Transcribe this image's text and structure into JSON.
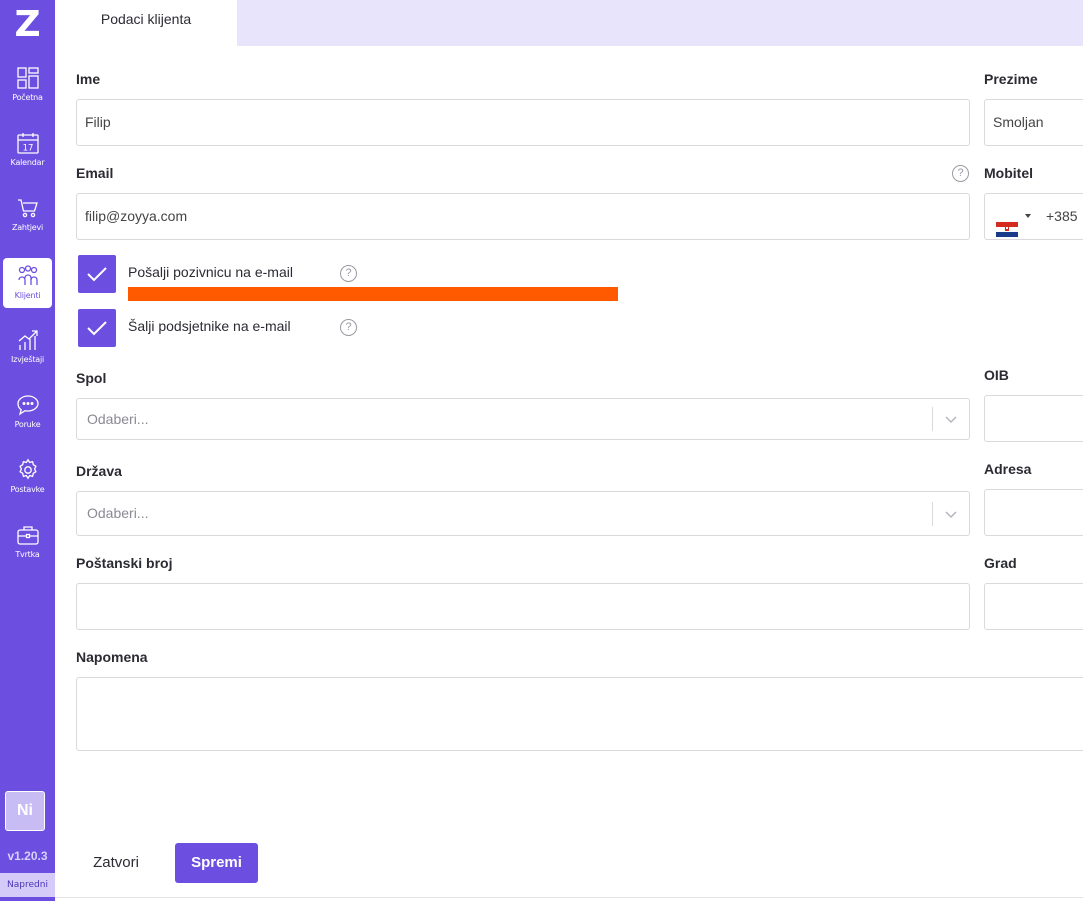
{
  "app": {
    "logo": "Z",
    "version": "v1.20.3",
    "plan": "Napredni",
    "avatar_initials": "Ni"
  },
  "sidebar": {
    "items": [
      {
        "label": "Početna",
        "icon": "dashboard-icon",
        "active": false
      },
      {
        "label": "Kalendar",
        "icon": "calendar-icon",
        "active": false,
        "day": "17"
      },
      {
        "label": "Zahtjevi",
        "icon": "cart-icon",
        "active": false
      },
      {
        "label": "Klijenti",
        "icon": "clients-icon",
        "active": true
      },
      {
        "label": "Izvještaji",
        "icon": "reports-icon",
        "active": false
      },
      {
        "label": "Poruke",
        "icon": "chat-icon",
        "active": false
      },
      {
        "label": "Postavke",
        "icon": "gear-icon",
        "active": false
      },
      {
        "label": "Tvrtka",
        "icon": "briefcase-icon",
        "active": false
      }
    ]
  },
  "tabs": {
    "active": "Podaci klijenta"
  },
  "form": {
    "first_name": {
      "label": "Ime",
      "value": "Filip"
    },
    "last_name": {
      "label": "Prezime",
      "value": "Smoljan"
    },
    "email": {
      "label": "Email",
      "value": "filip@zoyya.com",
      "help": "?"
    },
    "mobile": {
      "label": "Mobitel",
      "prefix": "+385",
      "country": "HR"
    },
    "send_invite": {
      "label": "Pošalji pozivnicu na e-mail",
      "checked": true,
      "help": "?"
    },
    "send_reminders": {
      "label": "Šalji podsjetnike na e-mail",
      "checked": true,
      "help": "?"
    },
    "gender": {
      "label": "Spol",
      "placeholder": "Odaberi..."
    },
    "oib": {
      "label": "OIB",
      "value": ""
    },
    "country": {
      "label": "Država",
      "placeholder": "Odaberi..."
    },
    "address": {
      "label": "Adresa",
      "value": ""
    },
    "postal_code": {
      "label": "Poštanski broj",
      "value": ""
    },
    "city": {
      "label": "Grad",
      "value": ""
    },
    "note": {
      "label": "Napomena",
      "value": ""
    }
  },
  "footer": {
    "close_label": "Zatvori",
    "save_label": "Spremi"
  },
  "colors": {
    "brand": "#6c4ee0",
    "tabbar": "#e7e4fb",
    "redaction": "#ff5a00"
  }
}
